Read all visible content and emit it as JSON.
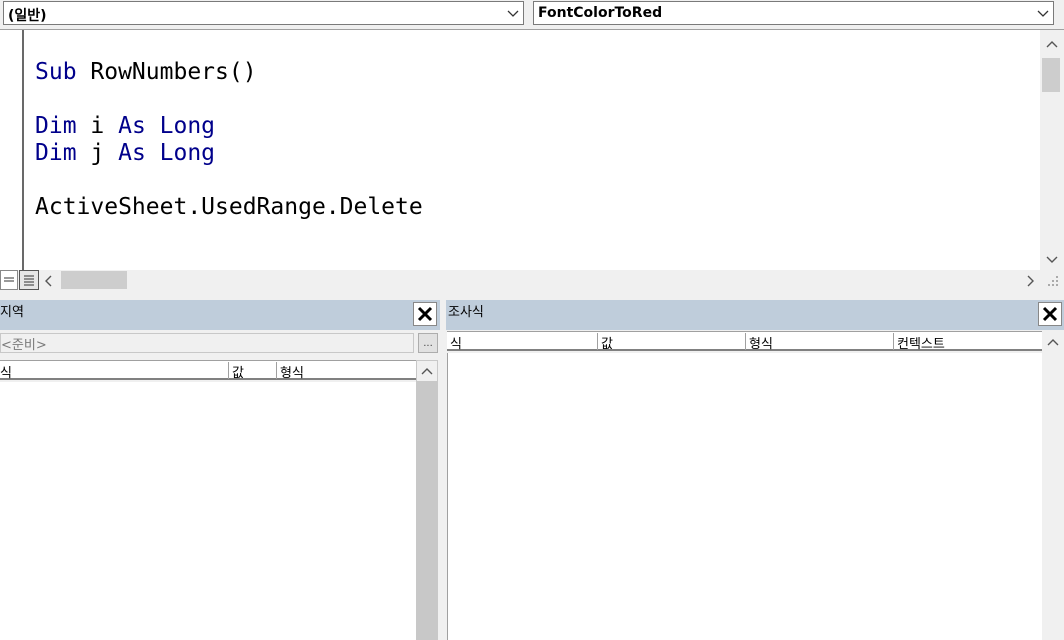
{
  "editor": {
    "object_combo": "(일반)",
    "procedure_combo": "FontColorToRed",
    "code_lines": [
      {
        "kw1": "Sub",
        "rest": " RowNumbers()"
      },
      {
        "kw1": "Dim",
        "mid": " i ",
        "kw2": "As",
        "tail": " Long"
      },
      {
        "kw1": "Dim",
        "mid": " j ",
        "kw2": "As",
        "tail": " Long"
      },
      {
        "plain": "ActiveSheet.UsedRange.Delete"
      }
    ]
  },
  "locals": {
    "title": "지역",
    "context": "<준비>",
    "ellipsis": "...",
    "columns": [
      "식",
      "값",
      "형식"
    ]
  },
  "watch": {
    "title": "조사식",
    "columns": [
      "식",
      "값",
      "형식",
      "컨텍스트"
    ]
  },
  "colors": {
    "keyword": "#00008b",
    "header_bg": "#bfcddb"
  }
}
